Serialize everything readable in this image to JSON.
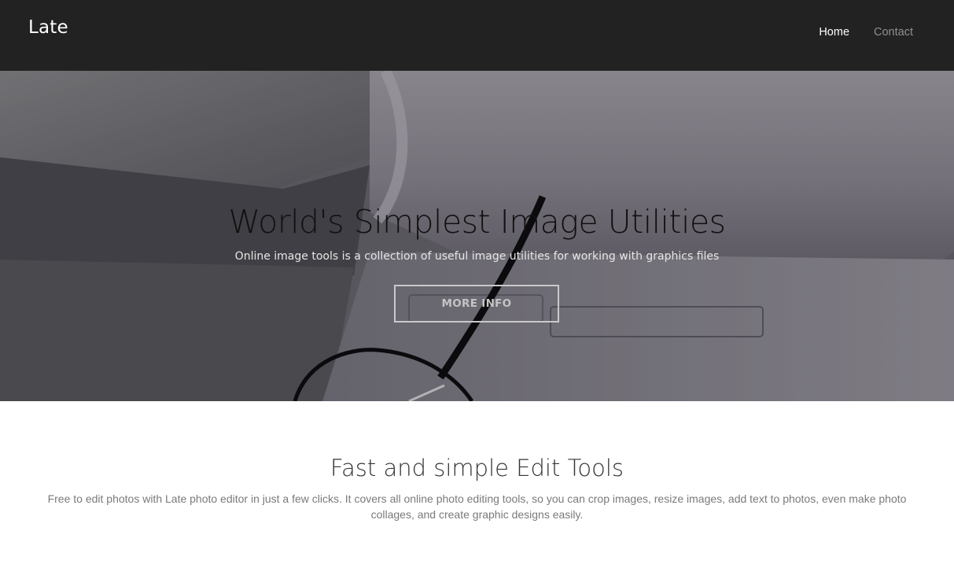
{
  "navbar": {
    "brand": "Late",
    "links": [
      {
        "label": "Home",
        "active": true
      },
      {
        "label": "Contact",
        "active": false
      }
    ]
  },
  "hero": {
    "title": "World's Simplest Image Utilities",
    "subtitle": "Online image tools is a collection of useful image utilities for working with graphics files",
    "button_label": "MORE INFO"
  },
  "features": {
    "title": "Fast and simple Edit Tools",
    "description": "Free to edit photos with Late photo editor in just a few clicks. It covers all online photo editing tools, so you can crop images, resize images, add text to photos, even make photo collages, and create graphic designs easily."
  },
  "colors": {
    "navbar_bg": "#222222",
    "nav_active": "#ffffff",
    "nav_muted": "#8f8f8f",
    "hero_title": "#111111",
    "body_text": "#7a7a7a"
  }
}
